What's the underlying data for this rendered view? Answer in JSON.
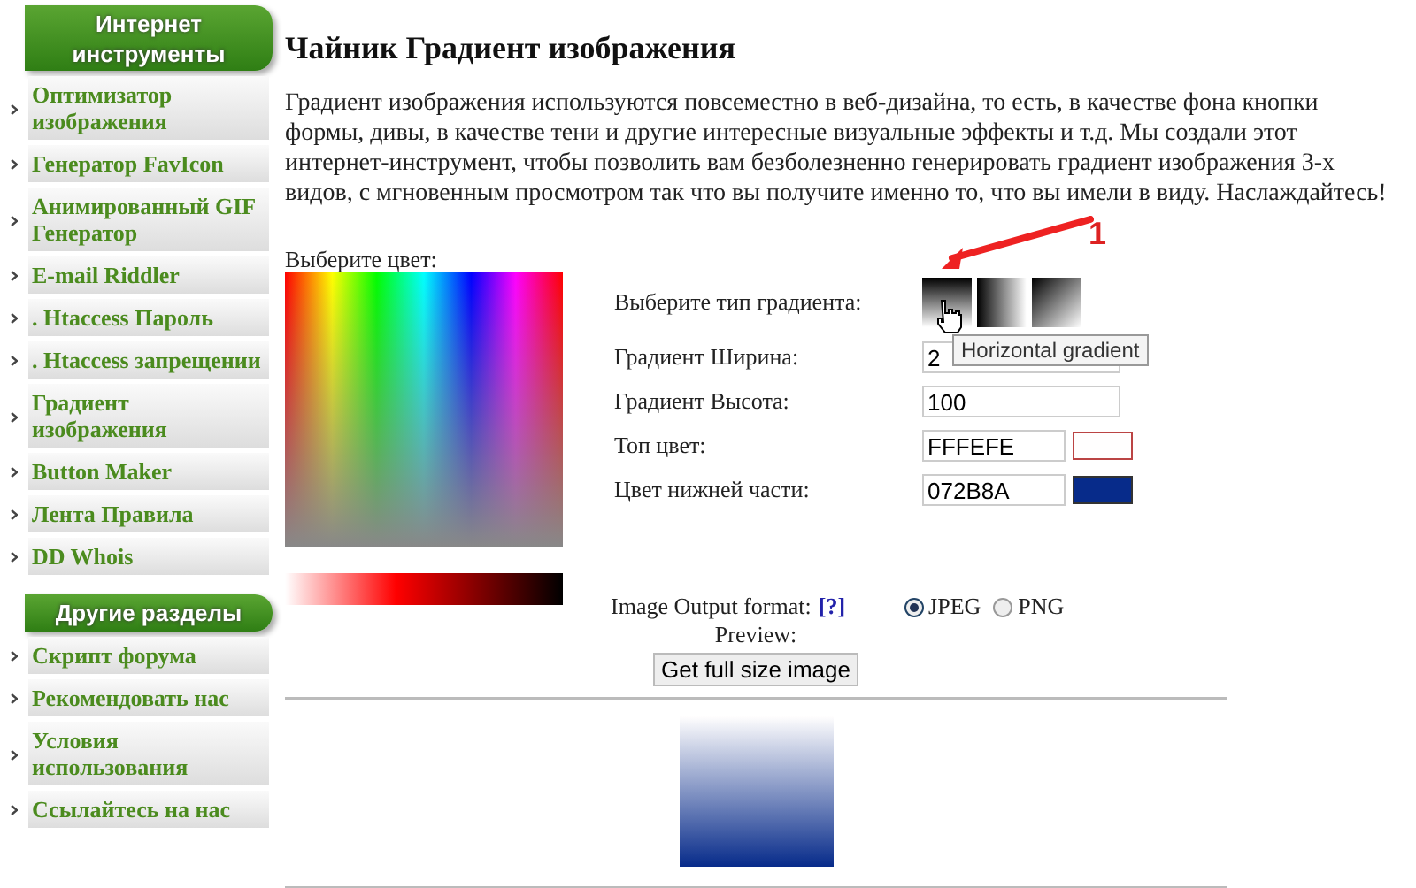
{
  "sidebar": {
    "sections": [
      {
        "header": "Интернет инструменты",
        "items": [
          {
            "label": "Оптимизатор изображения"
          },
          {
            "label": "Генератор FavIcon"
          },
          {
            "label": "Анимированный GIF Генератор"
          },
          {
            "label": "E-mail Riddler"
          },
          {
            "label": ". Htaccess Пароль"
          },
          {
            "label": ". Htaccess запрещении"
          },
          {
            "label": "Градиент изображения"
          },
          {
            "label": "Button Maker"
          },
          {
            "label": "Лента Правила"
          },
          {
            "label": "DD Whois"
          }
        ]
      },
      {
        "header": "Другие разделы",
        "items": [
          {
            "label": "Скрипт форума"
          },
          {
            "label": "Рекомендовать нас"
          },
          {
            "label": "Условия использования"
          },
          {
            "label": "Ссылайтесь на нас"
          }
        ]
      }
    ]
  },
  "title": "Чайник Градиент изображения",
  "intro": "Градиент изображения используются повсеместно в веб-дизайна, то есть, в качестве фона кнопки формы, дивы, в качестве тени и другие интересные визуальные эффекты и т.д. Мы создали этот интернет-инструмент, чтобы позволить вам безболезненно генерировать градиент изображения 3-х видов, с мгновенным просмотром так что вы получите именно то, что вы имели в виду. Наслаждайтесь!",
  "color_label": "Выберите цвет:",
  "form": {
    "type_label": "Выберите тип градиента:",
    "types": [
      {
        "kind": "horizontal"
      },
      {
        "kind": "vertical"
      },
      {
        "kind": "diagonal"
      }
    ],
    "tooltip": "Horizontal gradient",
    "annotation": "1",
    "width_label": "Градиент Ширина:",
    "width_value": "2",
    "height_label": "Градиент Высота:",
    "height_value": "100",
    "top_label": "Топ цвет:",
    "top_value": "FFFEFE",
    "bottom_label": "Цвет нижней части:",
    "bottom_value": "072B8A",
    "format_label": "Image Output format:",
    "format_help": "[?]",
    "formats": [
      {
        "label": "JPEG",
        "selected": true
      },
      {
        "label": "PNG",
        "selected": false
      }
    ]
  },
  "preview_label": "Preview:",
  "full_button": "Get full size image"
}
